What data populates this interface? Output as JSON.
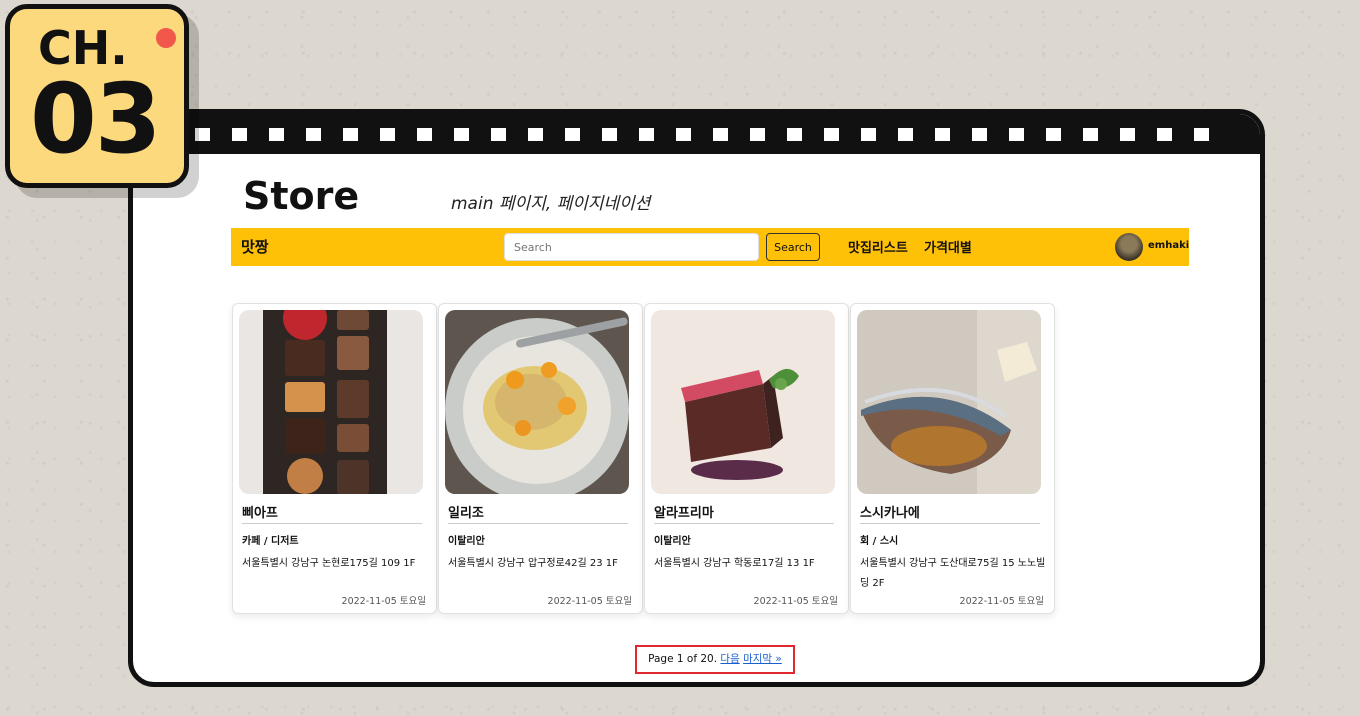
{
  "badge": {
    "chapter_label": "CH.",
    "chapter_number": "03"
  },
  "header": {
    "title": "Store",
    "subtitle": "main 페이지, 페이지네이션"
  },
  "navbar": {
    "brand": "맛짱",
    "search": {
      "placeholder": "Search",
      "value": ""
    },
    "search_button": "Search",
    "links": [
      "맛집리스트",
      "가격대별"
    ],
    "user": {
      "name": "emhaki"
    }
  },
  "cards": [
    {
      "name": "삐아프",
      "category": "카페 / 디저트",
      "address": "서울특별시 강남구 논현로175길 109 1F",
      "date": "2022-11-05 토요일"
    },
    {
      "name": "일리조",
      "category": "이탈리안",
      "address": "서울특별시 강남구 압구정로42길 23 1F",
      "date": "2022-11-05 토요일"
    },
    {
      "name": "알라프리마",
      "category": "이탈리안",
      "address": "서울특별시 강남구 학동로17길 13 1F",
      "date": "2022-11-05 토요일"
    },
    {
      "name": "스시카나에",
      "category": "회 / 스시",
      "address": "서울특별시 강남구 도산대로75길 15 노노빌딩 2F",
      "date": "2022-11-05 토요일"
    }
  ],
  "pagination": {
    "status": "Page 1 of 20.",
    "next": "다음",
    "last": "마지막 »"
  },
  "colors": {
    "navbar": "#ffc107",
    "badge": "#fdd97d",
    "badge_dot": "#f2574b",
    "highlight": "#e0282e",
    "link": "#1a5fd0"
  }
}
